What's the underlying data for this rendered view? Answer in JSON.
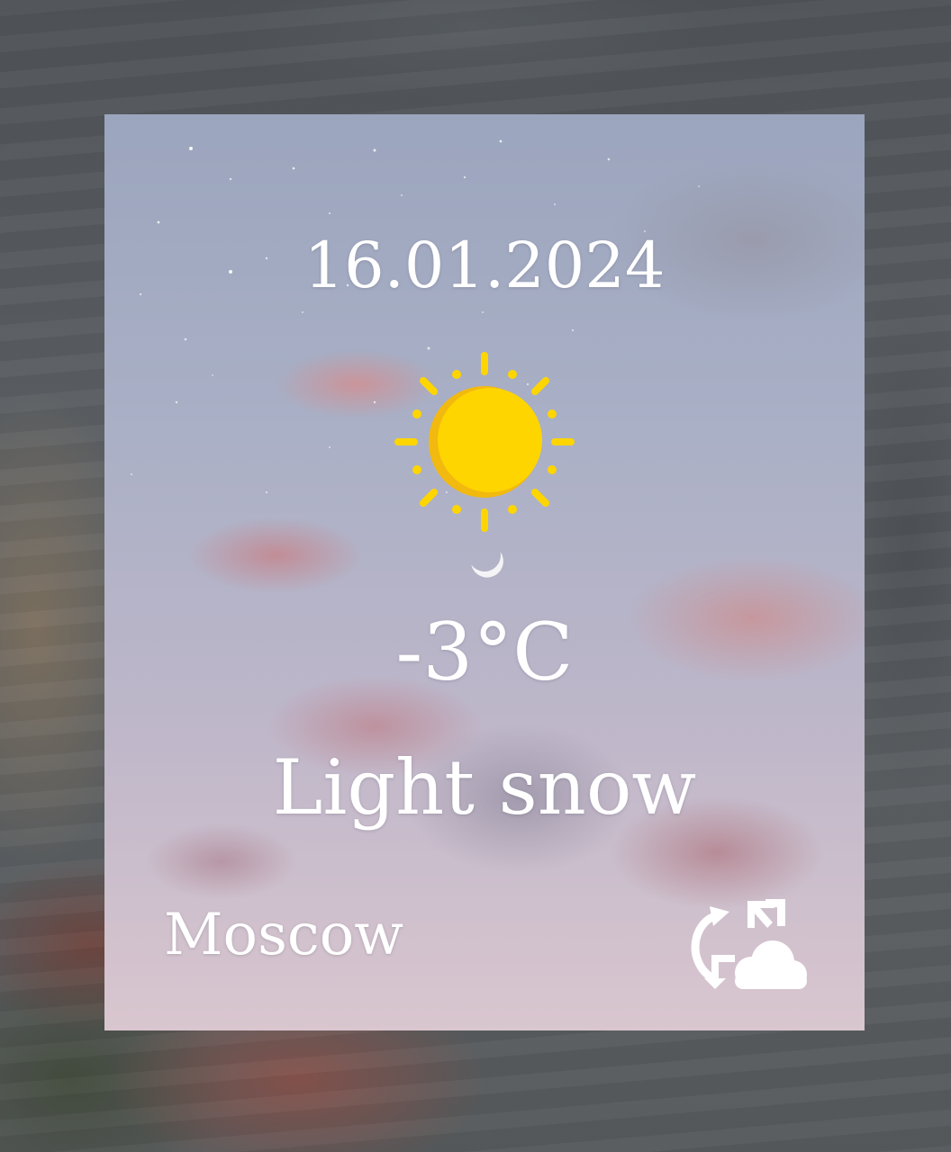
{
  "widget": {
    "date": "16.01.2024",
    "weather_icon": "sun-icon",
    "temperature": "-3°C",
    "condition": "Light snow",
    "city": "Moscow",
    "refresh_icon": "refresh-weather-icon",
    "colors": {
      "text": "#ffffff",
      "sun": "#ffd500",
      "sun_shadow": "#f2b90f"
    }
  }
}
